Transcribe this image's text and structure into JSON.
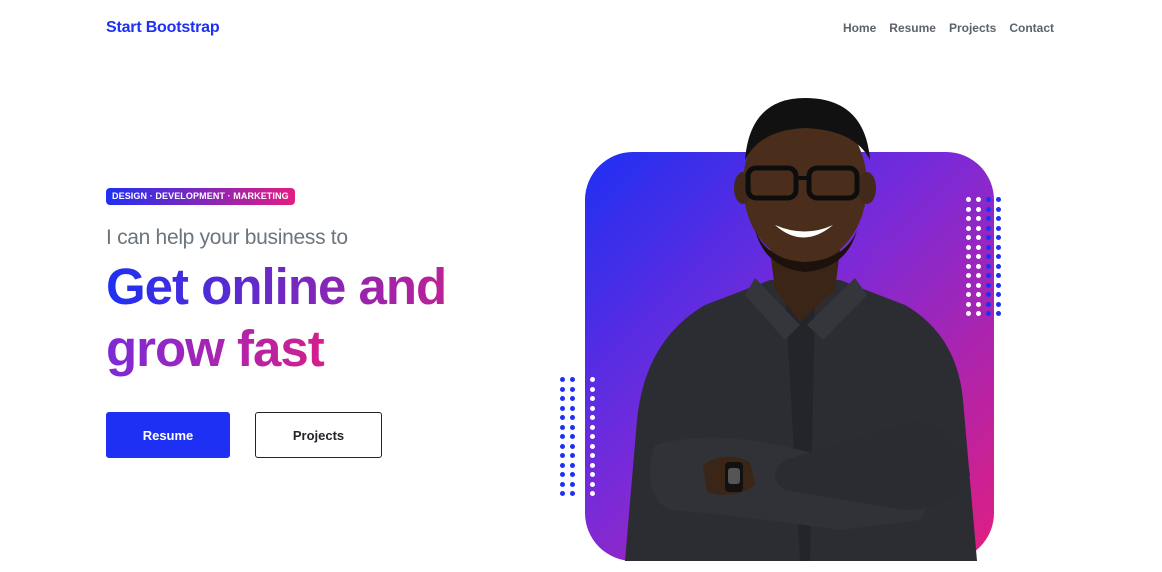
{
  "nav": {
    "brand": "Start Bootstrap",
    "links": [
      "Home",
      "Resume",
      "Projects",
      "Contact"
    ]
  },
  "hero": {
    "badge": "DESIGN · DEVELOPMENT · MARKETING",
    "lead": "I can help your business to",
    "headline_line1": "Get online and",
    "headline_line2": "grow fast",
    "primary_button": "Resume",
    "secondary_button": "Projects"
  },
  "colors": {
    "brand_blue": "#1e30f3",
    "brand_pink": "#e21e80",
    "dots_white": "#ffffff",
    "dots_blue": "#1e30f3"
  },
  "icons": [
    "profile-photo",
    "dot-pattern"
  ]
}
